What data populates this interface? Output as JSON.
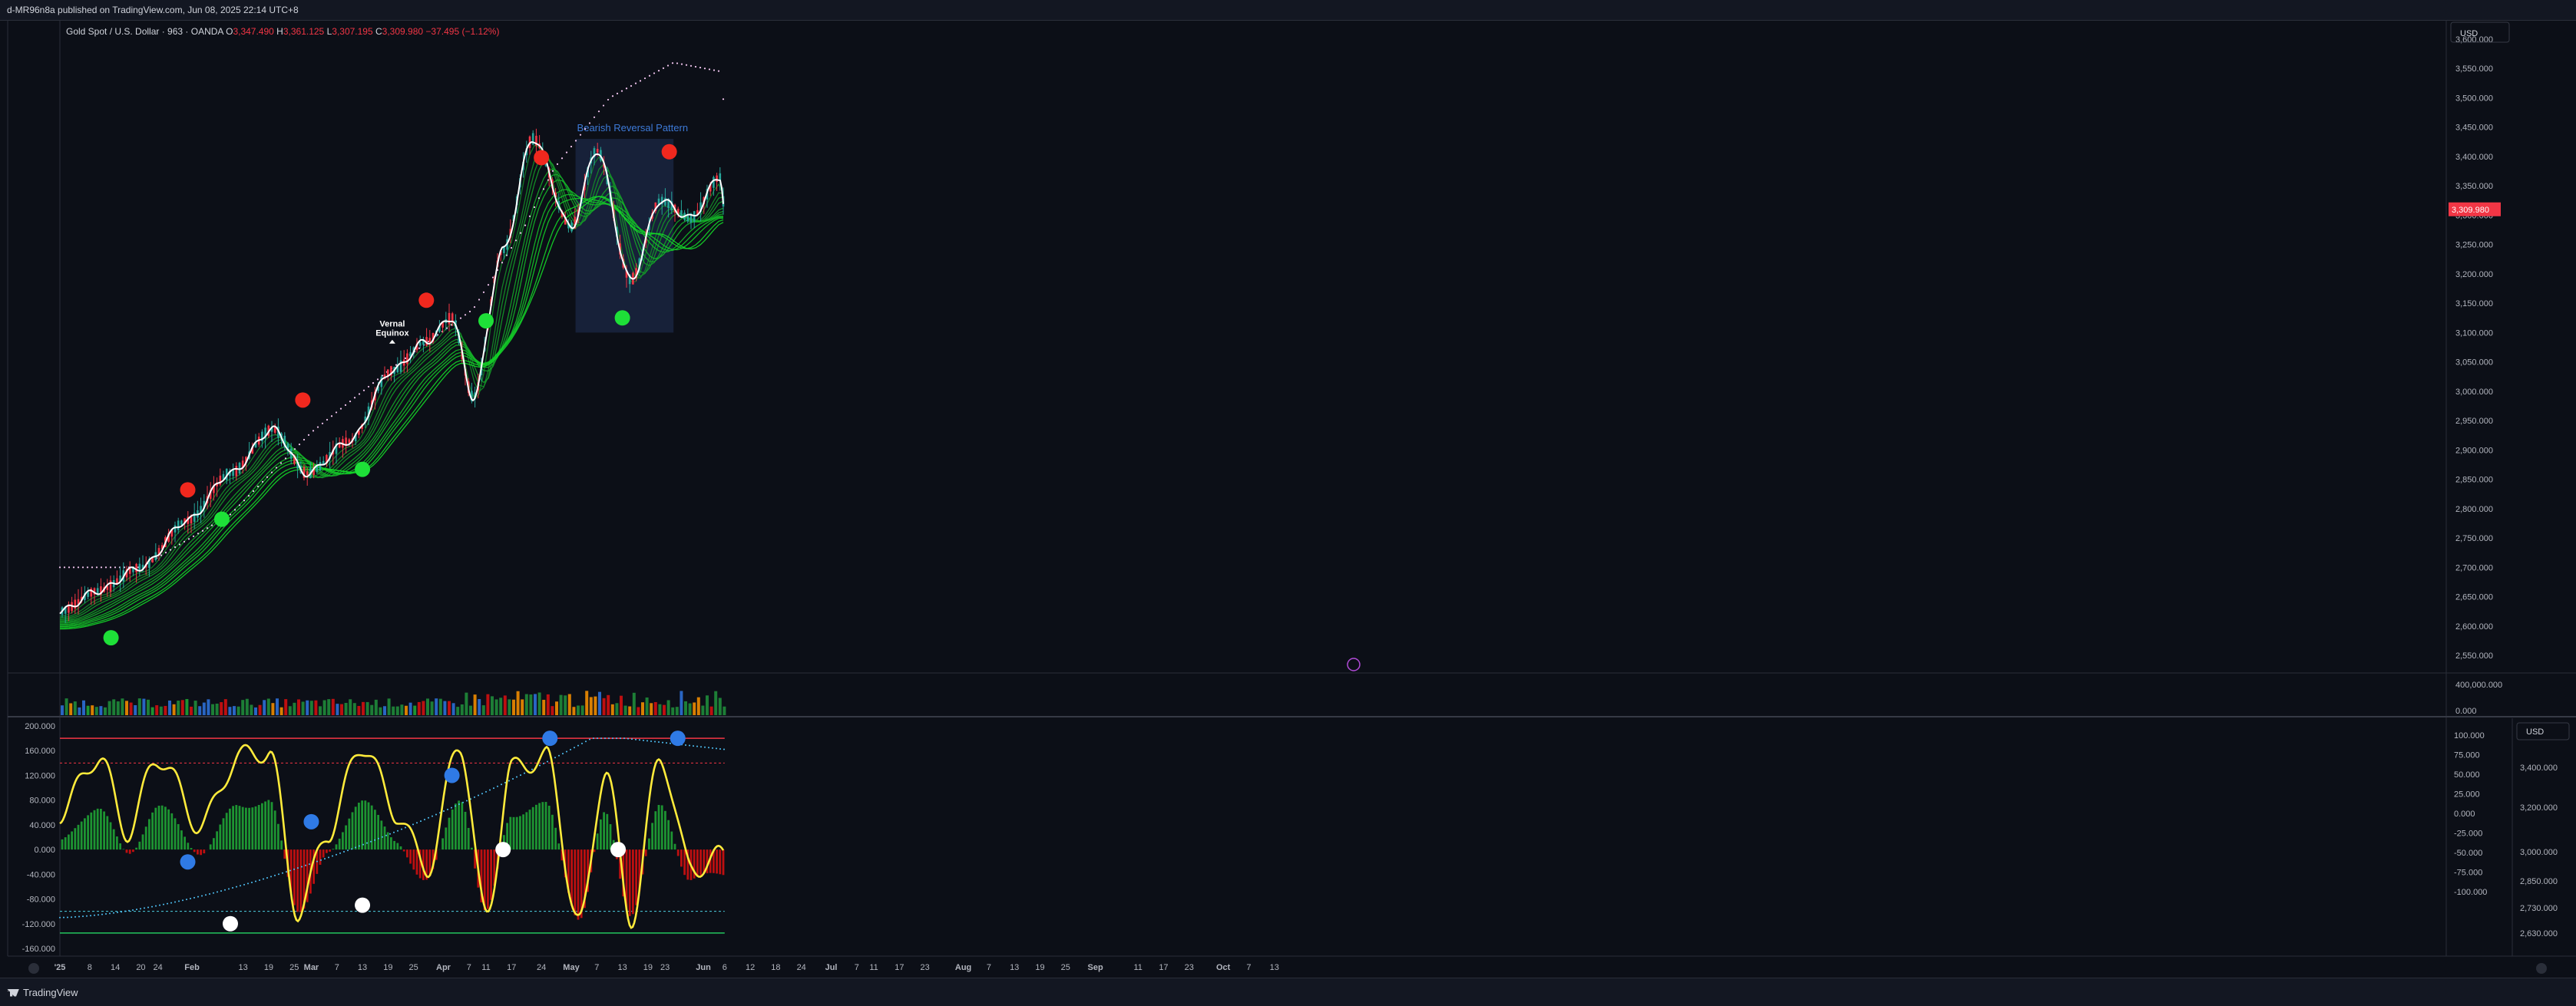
{
  "header": {
    "attribution": "d-MR96n8a published on TradingView.com, Jun 08, 2025 22:14 UTC+8"
  },
  "legend": {
    "symbol": "Gold Spot / U.S. Dollar · 963 · OANDA",
    "o_label": "O",
    "o_value": "3,347.490",
    "h_label": "H",
    "h_value": "3,361.125",
    "l_label": "L",
    "l_value": "3,307.195",
    "c_label": "C",
    "c_value": "3,309.980",
    "change": "−37.495 (−1.12%)"
  },
  "footer": {
    "brand": "TradingView"
  },
  "colors": {
    "background": "#0c0f17",
    "up": "#26a69a",
    "down": "#f23645",
    "price_line": "#ffffff",
    "ribbon": "#22c55e",
    "buy_dot": "#1ee038",
    "sell_dot": "#f0281e",
    "blue_dot": "#2f7ae5",
    "white_dot": "#ffffff",
    "oscillator": "#ffeb3b",
    "hist_up": "#1fa335",
    "hist_down": "#d01010",
    "box": "#1a2540",
    "box_label": "#3d7ad8"
  },
  "price_axis": {
    "currency": "USD",
    "ticks": [
      "3,600.000",
      "3,550.000",
      "3,500.000",
      "3,450.000",
      "3,400.000",
      "3,350.000",
      "3,300.000",
      "3,250.000",
      "3,200.000",
      "3,150.000",
      "3,100.000",
      "3,050.000",
      "3,000.000",
      "2,950.000",
      "2,900.000",
      "2,850.000",
      "2,800.000",
      "2,750.000",
      "2,700.000",
      "2,650.000",
      "2,600.000",
      "2,550.000"
    ],
    "last_price_label": "3,309.980"
  },
  "volume_axis": {
    "ticks": [
      "400,000.000",
      "0.000"
    ]
  },
  "osc_left_axis": {
    "ticks": [
      "200.000",
      "160.000",
      "120.000",
      "80.000",
      "40.000",
      "0.000",
      "-40.000",
      "-80.000",
      "-120.000",
      "-160.000"
    ]
  },
  "osc_right_axis": {
    "ticks": [
      "100.000",
      "75.000",
      "50.000",
      "25.000",
      "0.000",
      "-25.000",
      "-50.000",
      "-75.000",
      "-100.000"
    ]
  },
  "osc_far_right_axis": {
    "currency": "USD",
    "ticks": [
      "3,400.000",
      "3,200.000",
      "3,000.000",
      "2,850.000",
      "2,730.000",
      "2,630.000"
    ]
  },
  "time_axis": {
    "labels": [
      "'25",
      "8",
      "14",
      "20",
      "24",
      "Feb",
      "13",
      "19",
      "25",
      "Mar",
      "7",
      "13",
      "19",
      "25",
      "Apr",
      "7",
      "11",
      "17",
      "24",
      "May",
      "7",
      "13",
      "19",
      "23",
      "Jun",
      "6",
      "12",
      "18",
      "24",
      "Jul",
      "7",
      "11",
      "17",
      "23",
      "Aug",
      "7",
      "13",
      "19",
      "25",
      "Sep",
      "11",
      "17",
      "23",
      "Oct",
      "7",
      "13"
    ]
  },
  "annotations": {
    "equinox_line1": "Vernal",
    "equinox_line2": "Equinox",
    "pattern_label": "Bearish Reversal Pattern"
  },
  "chart_data": [
    {
      "type": "line",
      "title": "Gold Spot / U.S. Dollar · 963 · OANDA",
      "x": [
        "2025-01-01",
        "2025-01-10",
        "2025-01-20",
        "2025-01-31",
        "2025-02-10",
        "2025-02-20",
        "2025-02-28",
        "2025-03-10",
        "2025-03-20",
        "2025-03-28",
        "2025-04-03",
        "2025-04-08",
        "2025-04-15",
        "2025-04-22",
        "2025-05-01",
        "2025-05-07",
        "2025-05-15",
        "2025-05-22",
        "2025-05-29",
        "2025-06-05",
        "2025-06-06"
      ],
      "series": [
        {
          "values": [
            2625,
            2660,
            2700,
            2780,
            2860,
            2935,
            2860,
            2915,
            3035,
            3085,
            3125,
            2990,
            3240,
            3430,
            3280,
            3410,
            3190,
            3325,
            3295,
            3365,
            3310
          ]
        }
      ],
      "ylim": [
        2520,
        3630
      ],
      "markers": {
        "sell": [
          [
            "2025-01-31",
            2832
          ],
          [
            "2025-02-27",
            2985
          ],
          [
            "2025-03-28",
            3155
          ],
          [
            "2025-04-24",
            3398
          ],
          [
            "2025-05-24",
            3408
          ]
        ],
        "buy": [
          [
            "2025-01-13",
            2580
          ],
          [
            "2025-02-08",
            2782
          ],
          [
            "2025-03-13",
            2867
          ],
          [
            "2025-04-11",
            3120
          ],
          [
            "2025-05-13",
            3125
          ]
        ]
      },
      "annotations": [
        "Vernal Equinox",
        "Bearish Reversal Pattern"
      ]
    },
    {
      "type": "bar",
      "title": "Volume",
      "ylim": [
        0,
        400000
      ],
      "note": "daily volume bars beneath the price chart"
    },
    {
      "type": "line",
      "title": "Oscillator",
      "ylim": [
        -165,
        205
      ],
      "levels": [
        180,
        140,
        -100,
        -135
      ],
      "x": [
        "2025-01-01",
        "2025-01-10",
        "2025-01-17",
        "2025-01-24",
        "2025-02-03",
        "2025-02-12",
        "2025-02-19",
        "2025-02-26",
        "2025-03-05",
        "2025-03-13",
        "2025-03-21",
        "2025-03-28",
        "2025-04-05",
        "2025-04-11",
        "2025-04-17",
        "2025-04-25",
        "2025-05-03",
        "2025-05-09",
        "2025-05-15",
        "2025-05-22",
        "2025-05-29",
        "2025-06-06"
      ],
      "series": [
        {
          "values": [
            60,
            150,
            30,
            150,
            40,
            150,
            160,
            -100,
            30,
            170,
            60,
            -30,
            170,
            -110,
            130,
            150,
            -120,
            130,
            -110,
            150,
            -30,
            -10
          ]
        }
      ],
      "markers": {
        "blue": [
          [
            "2025-01-31",
            -20
          ],
          [
            "2025-02-29",
            45
          ],
          [
            "2025-04-03",
            120
          ],
          [
            "2025-04-26",
            180
          ],
          [
            "2025-05-26",
            180
          ]
        ],
        "white": [
          [
            "2025-02-10",
            -120
          ],
          [
            "2025-03-13",
            -90
          ],
          [
            "2025-04-15",
            0
          ],
          [
            "2025-05-12",
            0
          ]
        ]
      }
    }
  ]
}
